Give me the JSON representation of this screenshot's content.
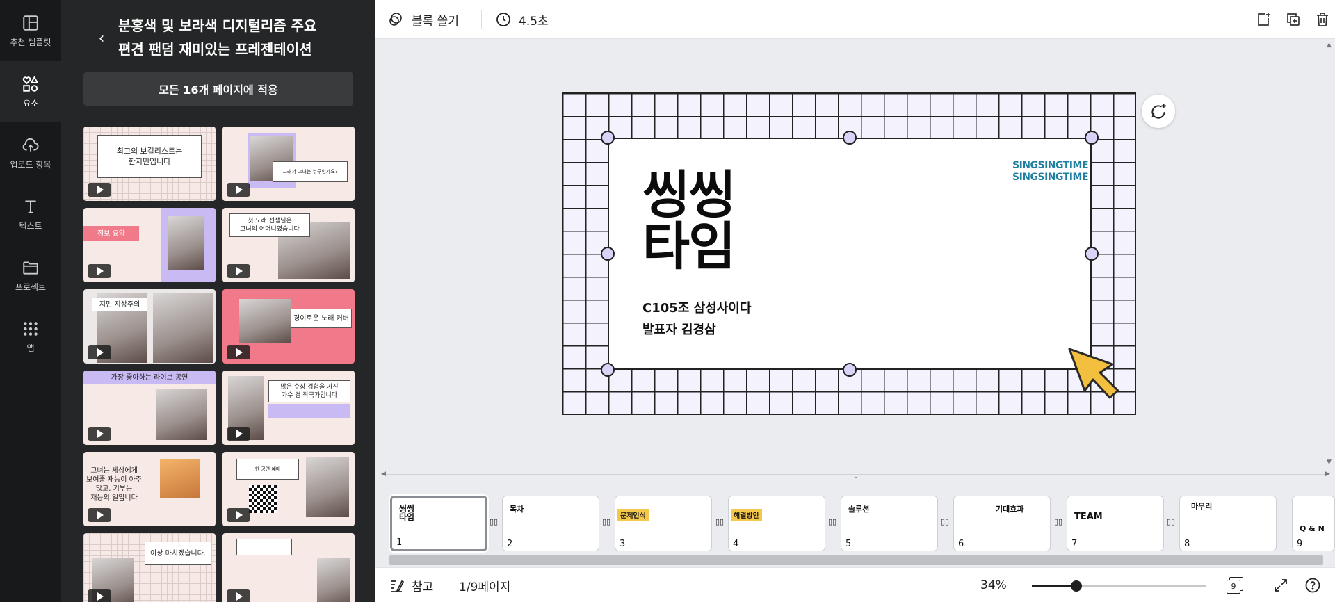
{
  "rail": {
    "items": [
      {
        "label": "추천 템플릿",
        "icon": "template-icon"
      },
      {
        "label": "요소",
        "icon": "elements-icon"
      },
      {
        "label": "업로드 항목",
        "icon": "upload-icon"
      },
      {
        "label": "텍스트",
        "icon": "text-icon"
      },
      {
        "label": "프로젝트",
        "icon": "folder-icon"
      },
      {
        "label": "앱",
        "icon": "apps-icon"
      }
    ]
  },
  "panel": {
    "title_line1": "분홍색 및 보라색 디지털리즘 주요",
    "title_line2": "편견 팬덤 재미있는 프레젠테이션",
    "apply_label": "모든 16개 페이지에 적용",
    "thumbs": [
      {
        "text": "최고의 보컬리스트는\n한지민입니다"
      },
      {
        "text": "그래서 그녀는 누구인가요?"
      },
      {
        "text": "정보 요약"
      },
      {
        "text": "첫 노래 선생님은\n그녀의 어머니였습니다"
      },
      {
        "text": "지민 지상주의"
      },
      {
        "text": "경이로운 노래 커버"
      },
      {
        "text": "가장 좋아하는 라이브 공연"
      },
      {
        "text": "많은 수상 경험을 가진\n가수 겸 작곡가입니다"
      },
      {
        "text": "그녀는 세상에게\n보여줄 재능이 아주\n많고, 기부는\n재능의 일입니다"
      },
      {
        "text": "한 공연 예매"
      },
      {
        "text": "이상 마치겠습니다."
      },
      {
        "text": ""
      }
    ]
  },
  "topbar": {
    "erase_label": "블록 쓸기",
    "duration_label": "4.5초"
  },
  "slide": {
    "title_line1": "씽씽",
    "title_line2": "타임",
    "sub_line1": "C105조 삼성사이다",
    "sub_line2": "발표자 김경삼",
    "logo_line1": "SINGSINGTIME",
    "logo_line2": "SINGSINGTIME"
  },
  "filmstrip": {
    "pages": [
      {
        "num": "1",
        "title": "씽씽\n타임"
      },
      {
        "num": "2",
        "title": "목차"
      },
      {
        "num": "3",
        "title": "문제인식"
      },
      {
        "num": "4",
        "title": "해결방안"
      },
      {
        "num": "5",
        "title": "솔루션"
      },
      {
        "num": "6",
        "title": "기대효과"
      },
      {
        "num": "7",
        "title": "TEAM"
      },
      {
        "num": "8",
        "title": "마무리"
      },
      {
        "num": "9",
        "title": "Q & N"
      }
    ]
  },
  "bottombar": {
    "notes_label": "참고",
    "page_indicator": "1/9페이지",
    "zoom": "34%",
    "zoom_fraction": 0.34,
    "page_count": "9"
  }
}
